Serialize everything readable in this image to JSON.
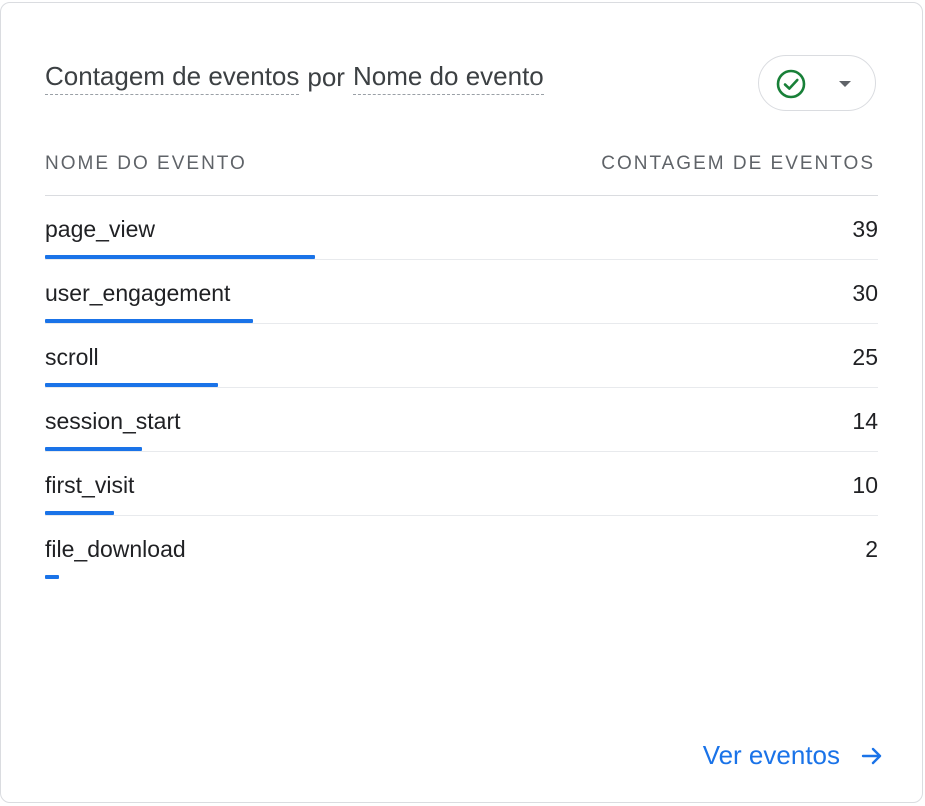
{
  "card": {
    "title_metric": "Contagem de eventos",
    "title_joiner": "por",
    "title_dimension": "Nome do evento",
    "status_icon": "check-circle-icon",
    "status_color": "#188038",
    "dropdown_icon": "caret-down-icon"
  },
  "table": {
    "col_name_header": "NOME DO EVENTO",
    "col_value_header": "CONTAGEM DE EVENTOS",
    "bar_color": "#1a73e8",
    "rows": [
      {
        "name": "page_view",
        "value": "39",
        "count": 39
      },
      {
        "name": "user_engagement",
        "value": "30",
        "count": 30
      },
      {
        "name": "scroll",
        "value": "25",
        "count": 25
      },
      {
        "name": "session_start",
        "value": "14",
        "count": 14
      },
      {
        "name": "first_visit",
        "value": "10",
        "count": 10
      },
      {
        "name": "file_download",
        "value": "2",
        "count": 2
      }
    ]
  },
  "footer": {
    "link_label": "Ver eventos",
    "link_icon": "arrow-right-icon"
  }
}
